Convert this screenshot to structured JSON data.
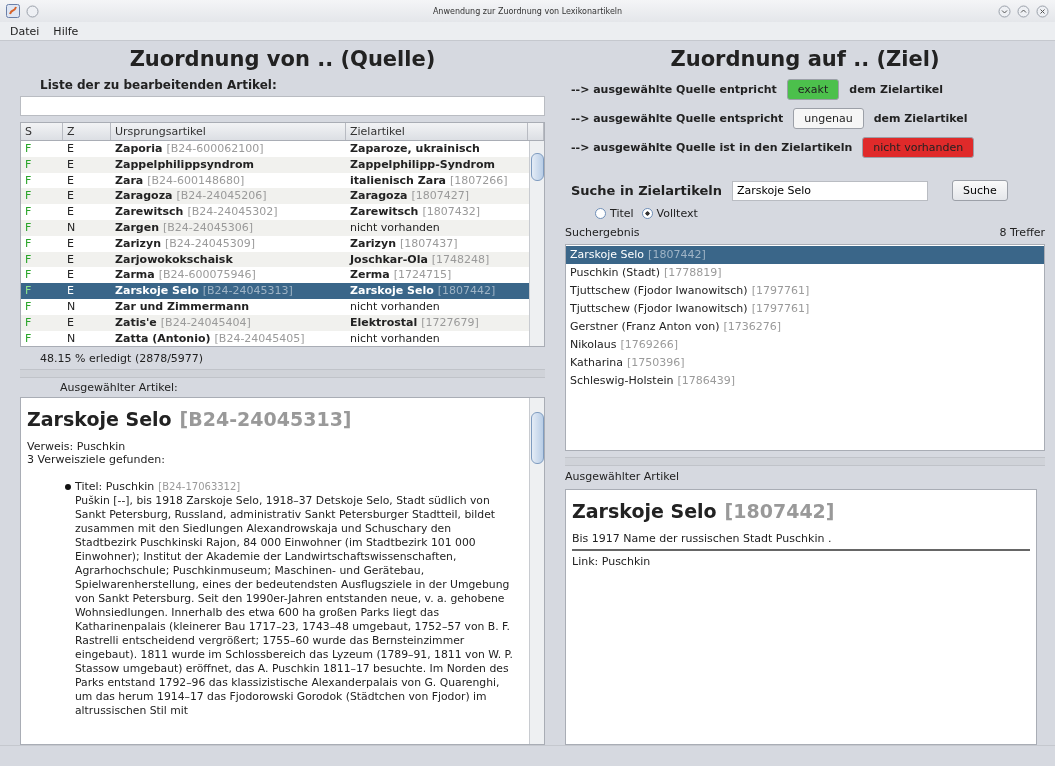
{
  "window": {
    "title": "Anwendung zur Zuordnung von Lexikonartikeln"
  },
  "menu": [
    "Datei",
    "Hilfe"
  ],
  "source": {
    "heading": "Zuordnung von .. (Quelle)",
    "list_label": "Liste der zu bearbeitenden Artikel:",
    "table": {
      "columns": [
        "S",
        "Z",
        "Ursprungsartikel",
        "Zielartikel"
      ],
      "rows": [
        {
          "s": "F",
          "z": "E",
          "source": "Zaporia",
          "source_id": "[B24-600062100]",
          "target": "Zaparoze, ukrainisch",
          "matched": true,
          "selected": false
        },
        {
          "s": "F",
          "z": "E",
          "source": "Zappelphilippsyndrom",
          "target": "Zappelphilipp-Syndrom",
          "matched": true,
          "selected": false
        },
        {
          "s": "F",
          "z": "E",
          "source": "Zara",
          "source_id": "[B24-600148680]",
          "target": "italienisch Zara",
          "target_id": "[1807266]",
          "matched": true,
          "selected": false
        },
        {
          "s": "F",
          "z": "E",
          "source": "Zaragoza",
          "source_id": "[B24-24045206]",
          "target": "Zaragoza",
          "target_id": "[1807427]",
          "matched": true,
          "selected": false
        },
        {
          "s": "F",
          "z": "E",
          "source": "Zarewitsch",
          "source_id": "[B24-24045302]",
          "target": "Zarewitsch",
          "target_id": "[1807432]",
          "matched": true,
          "selected": false
        },
        {
          "s": "F",
          "z": "N",
          "source": "Zargen",
          "source_id": "[B24-24045306]",
          "target": "nicht vorhanden",
          "matched": false,
          "selected": false
        },
        {
          "s": "F",
          "z": "E",
          "source": "Zarizyn",
          "source_id": "[B24-24045309]",
          "target": "Zarizyn",
          "target_id": "[1807437]",
          "matched": true,
          "selected": false
        },
        {
          "s": "F",
          "z": "E",
          "source": "Zarjowokokschaisk",
          "target": "Joschkar-Ola",
          "target_id": "[1748248]",
          "matched": true,
          "selected": false
        },
        {
          "s": "F",
          "z": "E",
          "source": "Zarma",
          "source_id": "[B24-600075946]",
          "target": "Zerma",
          "target_id": "[1724715]",
          "matched": true,
          "selected": false
        },
        {
          "s": "F",
          "z": "E",
          "source": "Zarskoje Selo",
          "source_id": "[B24-24045313]",
          "target": "Zarskoje Selo",
          "target_id": "[1807442]",
          "matched": true,
          "selected": true
        },
        {
          "s": "F",
          "z": "N",
          "source": "Zar und Zimmermann",
          "target": "nicht vorhanden",
          "matched": false,
          "selected": false
        },
        {
          "s": "F",
          "z": "E",
          "source": "Zatis'e",
          "source_id": "[B24-24045404]",
          "target": "Elektrostal",
          "target_id": "[1727679]",
          "matched": true,
          "selected": false
        },
        {
          "s": "F",
          "z": "N",
          "source": "Zatta (Antonio)",
          "source_id": "[B24-24045405]",
          "target": "nicht vorhanden",
          "matched": false,
          "selected": false
        }
      ]
    },
    "progress": "48.15 % erledigt (2878/5977)",
    "article_label": "Ausgewählter Artikel:",
    "article": {
      "title": "Zarskoje Selo",
      "id": "[B24-24045313]",
      "lines": [
        "Verweis: Puschkin",
        "3 Verweisziele gefunden:"
      ],
      "items": [
        {
          "label": "Titel: Puschkin",
          "id": "[B24-17063312]",
          "text": "Puškin [--], bis 1918 Zarskoje Selo, 1918–37 Detskoje Selo, Stadt südlich von Sankt Petersburg, Russland, administrativ Sankt Petersburger Stadtteil, bildet zusammen mit den Siedlungen Alexandrowskaja und Schuschary den Stadtbezirk Puschkinski Rajon, 84 000 Einwohner (im Stadtbezirk 101 000 Einwohner); Institut der Akademie der Landwirtschaftswissenschaften, Agrarhochschule; Puschkinmuseum; Maschinen- und Gerätebau, Spielwarenherstellung, eines der bedeutendsten Ausflugsziele in der Umgebung von Sankt Petersburg. Seit den 1990er-Jahren entstanden neue, v. a. gehobene Wohnsiedlungen. Innerhalb des etwa 600 ha großen Parks liegt das Katharinenpalais (kleinerer Bau 1717–23, 1743–48 umgebaut, 1752–57 von B. F. Rastrelli entscheidend vergrößert; 1755–60 wurde das Bernsteinzimmer eingebaut). 1811 wurde im Schlossbereich das Lyzeum (1789–91, 1811 von W. P. Stassow umgebaut) eröffnet, das A. Puschkin 1811–17 besuchte. Im Norden des Parks entstand 1792–96 das klassizistische Alexanderpalais von G. Quarenghi, um das herum 1914–17 das Fjodorowski Gorodok (Städtchen von Fjodor) im altrussischen Stil mit"
        }
      ]
    }
  },
  "target": {
    "heading": "Zuordnung auf .. (Ziel)",
    "decisions": [
      {
        "before": "--> ausgewählte Quelle entpricht",
        "button": "exakt",
        "color": "#4cc04c",
        "after": "dem Zielartikel"
      },
      {
        "before": "--> ausgewählte Quelle entspricht",
        "button": "ungenau",
        "color": "#f6f6f6",
        "after": "dem Zielartikel"
      },
      {
        "before": "--> ausgewählte Quelle ist in den Zielartikeln",
        "button": "nicht vorhanden",
        "color": "#e02a2a"
      }
    ],
    "search": {
      "label": "Suche in Zielartikeln",
      "value": "Zarskoje Selo",
      "button": "Suche"
    },
    "modes": [
      {
        "label": "Titel",
        "selected": false
      },
      {
        "label": "Volltext",
        "selected": true
      }
    ],
    "results_label": "Suchergebnis",
    "hits": "8 Treffer",
    "results": [
      {
        "name": "Zarskoje Selo",
        "id": "[1807442]",
        "selected": true
      },
      {
        "name": "Puschkin (Stadt)",
        "id": "[1778819]",
        "selected": false
      },
      {
        "name": "Tjuttschew (Fjodor Iwanowitsch)",
        "id": "[1797761]",
        "selected": false
      },
      {
        "name": "Tjuttschew (Fjodor Iwanowitsch)",
        "id": "[1797761]",
        "selected": false
      },
      {
        "name": "Gerstner (Franz Anton von)",
        "id": "[1736276]",
        "selected": false
      },
      {
        "name": "Nikolaus",
        "id": "[1769266]",
        "selected": false
      },
      {
        "name": "Katharina",
        "id": "[1750396]",
        "selected": false
      },
      {
        "name": "Schleswig-Holstein",
        "id": "[1786439]",
        "selected": false
      }
    ],
    "article_label": "Ausgewählter Artikel",
    "article": {
      "title": "Zarskoje Selo",
      "id": "[1807442]",
      "summary": "Bis 1917 Name der russischen Stadt Puschkin .",
      "link": "Link: Puschkin"
    }
  }
}
